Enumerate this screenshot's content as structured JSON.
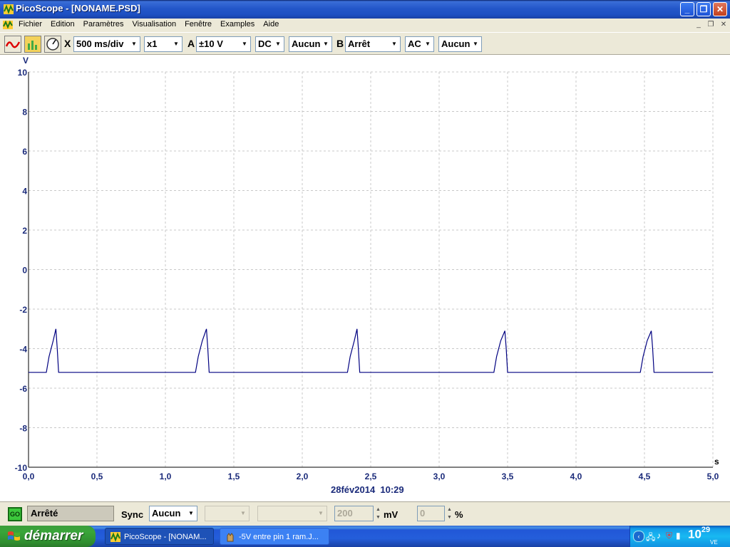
{
  "window": {
    "title": "PicoScope - [NONAME.PSD]"
  },
  "menu": [
    "Fichier",
    "Edition",
    "Paramètres",
    "Visualisation",
    "Fenêtre",
    "Examples",
    "Aide"
  ],
  "toolbar": {
    "x_label": "X",
    "timebase": "500 ms/div",
    "zoom": "x1",
    "channel_a_label": "A",
    "channel_a_range": "±10 V",
    "channel_a_coupling": "DC",
    "channel_a_filter": "Aucun",
    "channel_b_label": "B",
    "channel_b_range": "Arrêt",
    "channel_b_coupling": "AC",
    "channel_b_filter": "Aucun"
  },
  "plot": {
    "y_unit": "V",
    "x_unit": "s",
    "timestamp": "28fév2014  10:29"
  },
  "chart_data": {
    "type": "line",
    "ylim": [
      -10,
      10
    ],
    "xlim": [
      0,
      5
    ],
    "grid": true,
    "y_ticks": [
      "10",
      "8",
      "6",
      "4",
      "2",
      "0",
      "-2",
      "-4",
      "-6",
      "-8",
      "-10"
    ],
    "x_ticks": [
      "0,0",
      "0,5",
      "1,0",
      "1,5",
      "2,0",
      "2,5",
      "3,0",
      "3,5",
      "4,0",
      "4,5",
      "5,0"
    ],
    "series": [
      {
        "color": "#000080",
        "x": [
          0,
          0.13,
          0.15,
          0.18,
          0.2,
          0.21,
          0.22,
          1.22,
          1.24,
          1.27,
          1.3,
          1.31,
          1.32,
          2.33,
          2.35,
          2.38,
          2.4,
          2.41,
          2.42,
          3.4,
          3.42,
          3.45,
          3.48,
          3.49,
          3.5,
          4.47,
          4.49,
          4.52,
          4.55,
          4.56,
          4.57,
          5.0
        ],
        "y": [
          -5.2,
          -5.2,
          -4.4,
          -3.6,
          -3.0,
          -4.0,
          -5.2,
          -5.2,
          -4.4,
          -3.6,
          -3.0,
          -4.0,
          -5.2,
          -5.2,
          -4.4,
          -3.6,
          -3.0,
          -4.0,
          -5.2,
          -5.2,
          -4.4,
          -3.6,
          -3.1,
          -4.0,
          -5.2,
          -5.2,
          -4.4,
          -3.6,
          -3.1,
          -4.0,
          -5.2,
          -5.2
        ]
      }
    ]
  },
  "status": {
    "go_label": "GO",
    "state": "Arrêté",
    "sync_label": "Sync",
    "sync_value": "Aucun",
    "threshold_value": "200",
    "threshold_unit": "mV",
    "hysteresis_value": "0",
    "hysteresis_unit": "%"
  },
  "taskbar": {
    "start_label": "démarrer",
    "tasks": [
      "PicoScope - [NONAM...",
      "-5V entre pin 1 ram.J..."
    ],
    "clock_hour": "10",
    "clock_min": "29",
    "clock_day": "VE"
  }
}
